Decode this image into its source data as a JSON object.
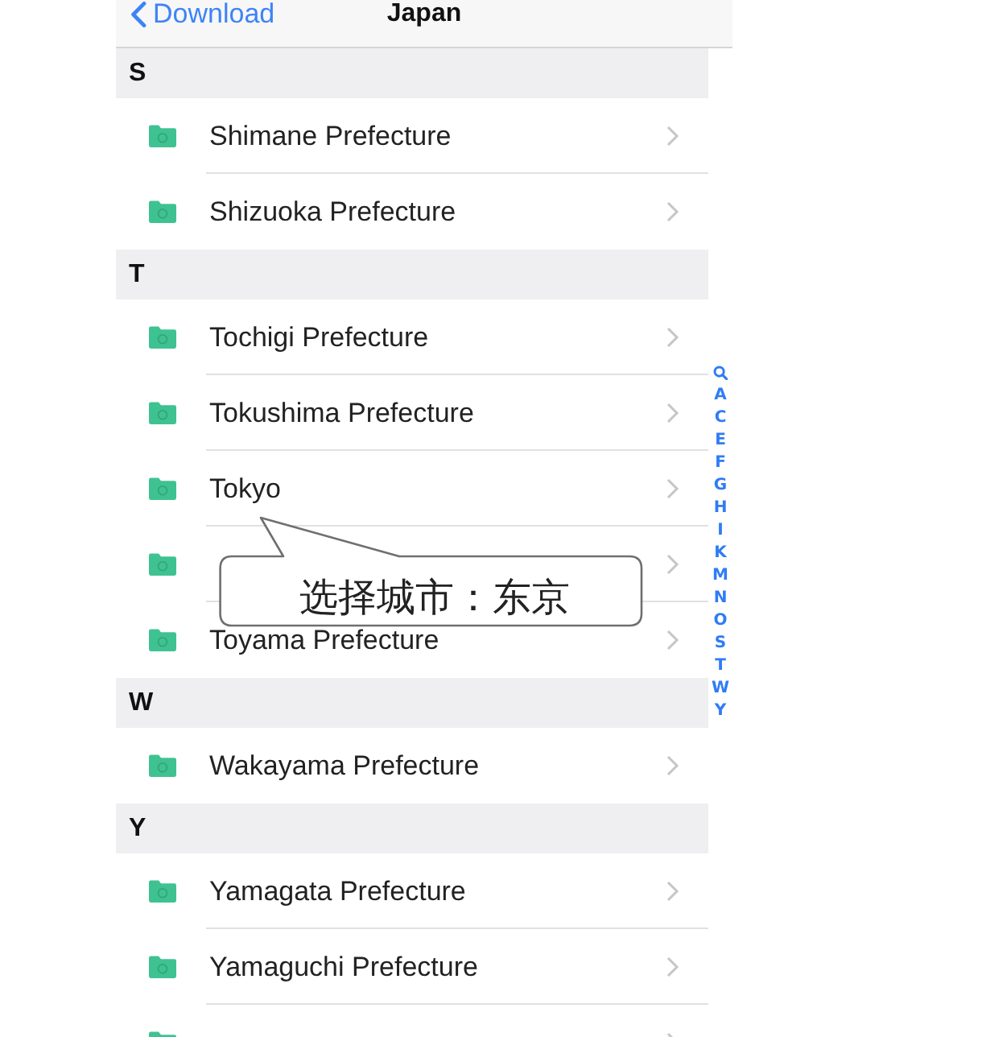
{
  "nav_bar": {
    "back_label": "Download",
    "title": "Japan"
  },
  "sections": [
    {
      "letter": "S",
      "rows": [
        {
          "label": "Shimane Prefecture"
        },
        {
          "label": "Shizuoka Prefecture"
        }
      ]
    },
    {
      "letter": "T",
      "rows": [
        {
          "label": "Tochigi Prefecture"
        },
        {
          "label": "Tokushima Prefecture"
        },
        {
          "label": "Tokyo"
        },
        {},
        {
          "label": "Toyama Prefecture"
        }
      ]
    },
    {
      "letter": "W",
      "rows": [
        {
          "label": "Wakayama Prefecture"
        }
      ]
    },
    {
      "letter": "Y",
      "rows": [
        {
          "label": "Yamagata Prefecture"
        },
        {
          "label": "Yamaguchi Prefecture"
        },
        {}
      ]
    }
  ],
  "section_index": [
    "A",
    "C",
    "E",
    "F",
    "G",
    "H",
    "I",
    "K",
    "M",
    "N",
    "O",
    "S",
    "T",
    "W",
    "Y"
  ],
  "callout": {
    "text": "选择城市：东京"
  }
}
